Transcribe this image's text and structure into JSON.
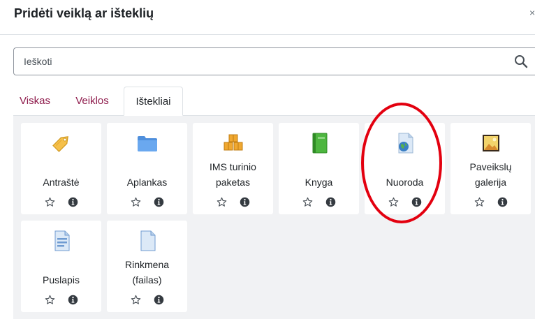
{
  "dialog": {
    "title": "Pridėti veiklą ar išteklių",
    "close_glyph": "×"
  },
  "search": {
    "placeholder": "Ieškoti",
    "value": ""
  },
  "tabs": [
    {
      "label": "Viskas",
      "active": false
    },
    {
      "label": "Veiklos",
      "active": false
    },
    {
      "label": "Ištekliai",
      "active": true
    }
  ],
  "resources": [
    {
      "label": "Antraštė",
      "icon": "label-tag-icon"
    },
    {
      "label": "Aplankas",
      "icon": "folder-icon"
    },
    {
      "label": "IMS turinio\npaketas",
      "icon": "ims-package-icon"
    },
    {
      "label": "Knyga",
      "icon": "book-icon"
    },
    {
      "label": "Nuoroda",
      "icon": "url-globe-icon"
    },
    {
      "label": "Paveikslų\ngalerija",
      "icon": "image-gallery-icon"
    },
    {
      "label": "Puslapis",
      "icon": "page-icon"
    },
    {
      "label": "Rinkmena\n(failas)",
      "icon": "file-icon"
    }
  ],
  "colors": {
    "link": "#8e1a4b",
    "annotation": "#e3000f",
    "background": "#f1f2f4"
  }
}
